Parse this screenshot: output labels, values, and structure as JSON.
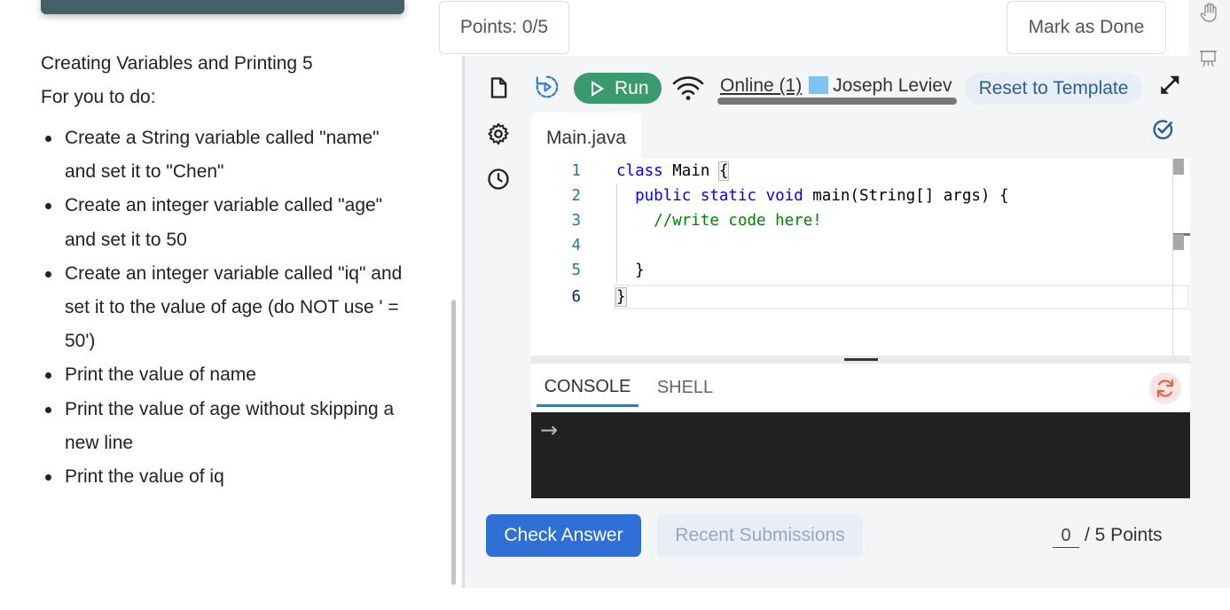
{
  "lesson": {
    "title": "Creating Variables and Printing 5",
    "subtitle": "For you to do:",
    "tasks": [
      "Create a String variable called \"name\" and set it to \"Chen\"",
      "Create an integer variable called \"age\" and set it to 50",
      "Create an integer variable called \"iq\" and set it to the value of age (do NOT use ' = 50')",
      "Print the value of name",
      "Print the value of age without skipping a new line",
      "Print the value of iq"
    ]
  },
  "header": {
    "points": "Points: 0/5",
    "mark_done": "Mark as Done"
  },
  "toolbar": {
    "run_label": "Run",
    "online_text": "Online (1)",
    "user_name": "Joseph Leviev",
    "reset_label": "Reset to Template"
  },
  "editor": {
    "file_tab": "Main.java",
    "line_numbers": [
      "1",
      "2",
      "3",
      "4",
      "5",
      "6"
    ],
    "lines": [
      "class Main {",
      "  public static void main(String[] args) {",
      "    //write code here!",
      "",
      "  }",
      "}"
    ]
  },
  "console": {
    "tab_console": "CONSOLE",
    "tab_shell": "SHELL",
    "prompt": "→"
  },
  "footer": {
    "check_answer": "Check Answer",
    "recent_submissions": "Recent Submissions",
    "score_value": "0",
    "score_total": "/ 5 Points"
  },
  "colors": {
    "run_green": "#3a9a6e",
    "primary_blue": "#2f6fd6",
    "terminal_bg": "#222222",
    "user_swatch": "#7fc3ef"
  },
  "icons": [
    "file-icon",
    "history-run-icon",
    "play-icon",
    "wifi-icon",
    "expand-icon",
    "settings-icon",
    "clock-icon",
    "check-circle-icon",
    "refresh-icon",
    "hand-icon",
    "presentation-icon"
  ]
}
